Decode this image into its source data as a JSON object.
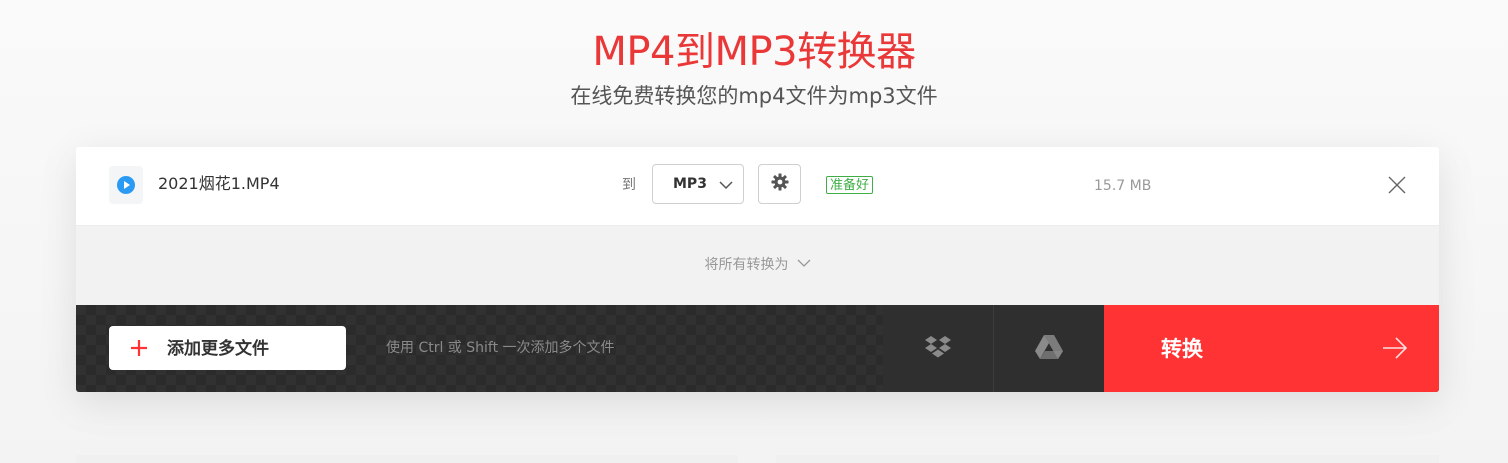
{
  "header": {
    "title": "MP4到MP3转换器",
    "subtitle": "在线免费转换您的mp4文件为mp3文件"
  },
  "file": {
    "icon": "play-circle-icon",
    "name": "2021烟花1.MP4",
    "to_label": "到",
    "format": "MP3",
    "status": "准备好",
    "size": "15.7 MB"
  },
  "convert_all": {
    "label": "将所有转换为"
  },
  "actions": {
    "add_files_label": "添加更多文件",
    "hint": "使用 Ctrl 或 Shift 一次添加多个文件",
    "dropbox_icon": "dropbox-icon",
    "gdrive_icon": "google-drive-icon",
    "convert_label": "转换"
  },
  "colors": {
    "brand_red": "#ff3333",
    "title_red": "#ea3737",
    "status_green": "#3fae45",
    "icon_blue": "#2b9af3"
  }
}
